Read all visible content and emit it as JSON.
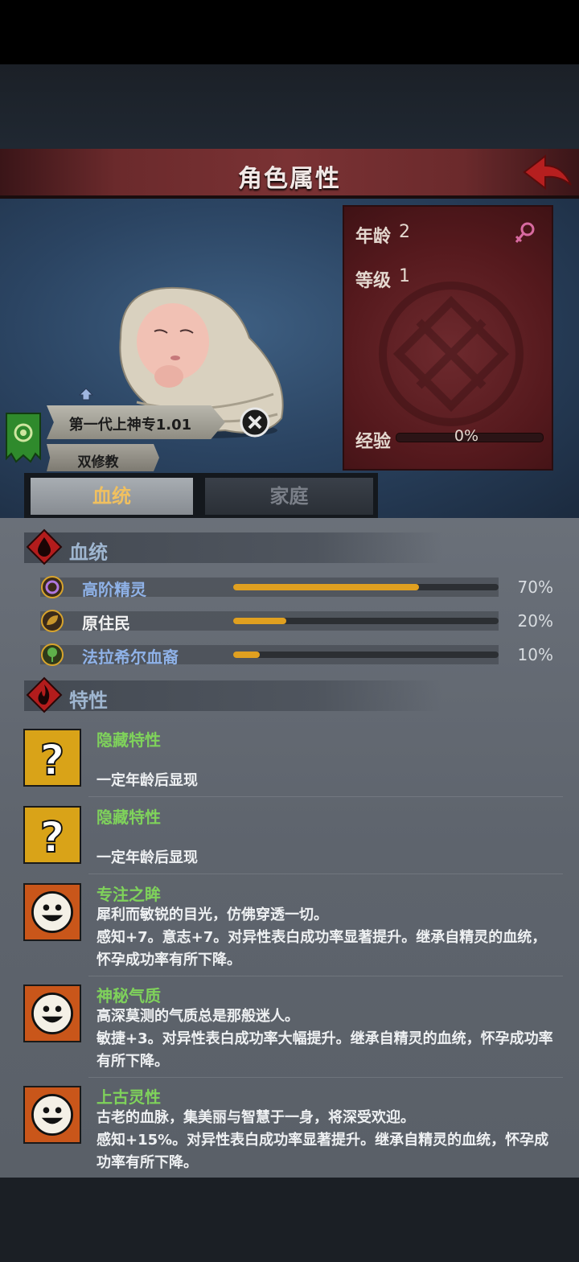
{
  "header": {
    "title": "角色属性"
  },
  "character": {
    "age_label": "年龄",
    "age_value": "2",
    "level_label": "等级",
    "level_value": "1",
    "exp_label": "经验",
    "exp_text": "0%",
    "exp_fraction": 0,
    "name": "第一代上神专1.01",
    "religion": "双修教"
  },
  "tabs": [
    {
      "label": "血统",
      "active": true
    },
    {
      "label": "家庭",
      "active": false
    }
  ],
  "lineage": {
    "title": "血统",
    "items": [
      {
        "name": "高阶精灵",
        "percent_text": "70%",
        "value": 70,
        "color": "#8fb2e8",
        "icon": "elf-rune-icon"
      },
      {
        "name": "原住民",
        "percent_text": "20%",
        "value": 20,
        "color": "#f2f2f2",
        "icon": "leaf-icon"
      },
      {
        "name": "法拉希尔血裔",
        "percent_text": "10%",
        "value": 10,
        "color": "#8fb2e8",
        "icon": "tree-icon"
      }
    ]
  },
  "traits": {
    "title": "特性",
    "items": [
      {
        "name": "隐藏特性",
        "lines": [
          "",
          "一定年龄后显现"
        ],
        "icon": "question-icon"
      },
      {
        "name": "隐藏特性",
        "lines": [
          "",
          "一定年龄后显现"
        ],
        "icon": "question-icon"
      },
      {
        "name": "专注之眸",
        "lines": [
          "犀利而敏锐的目光，仿佛穿透一切。",
          "感知+7。意志+7。对异性表白成功率显著提升。继承自精灵的血统，",
          "怀孕成功率有所下降。"
        ],
        "icon": "smiley-icon"
      },
      {
        "name": "神秘气质",
        "lines": [
          "高深莫测的气质总是那般迷人。",
          "敏捷+3。对异性表白成功率大幅提升。继承自精灵的血统，怀孕成功率",
          "有所下降。"
        ],
        "icon": "smiley-icon"
      },
      {
        "name": "上古灵性",
        "lines": [
          "古老的血脉，集美丽与智慧于一身，将深受欢迎。",
          "感知+15%。对异性表白成功率显著提升。继承自精灵的血统，怀孕成",
          "功率有所下降。"
        ],
        "icon": "smiley-icon"
      }
    ]
  }
}
